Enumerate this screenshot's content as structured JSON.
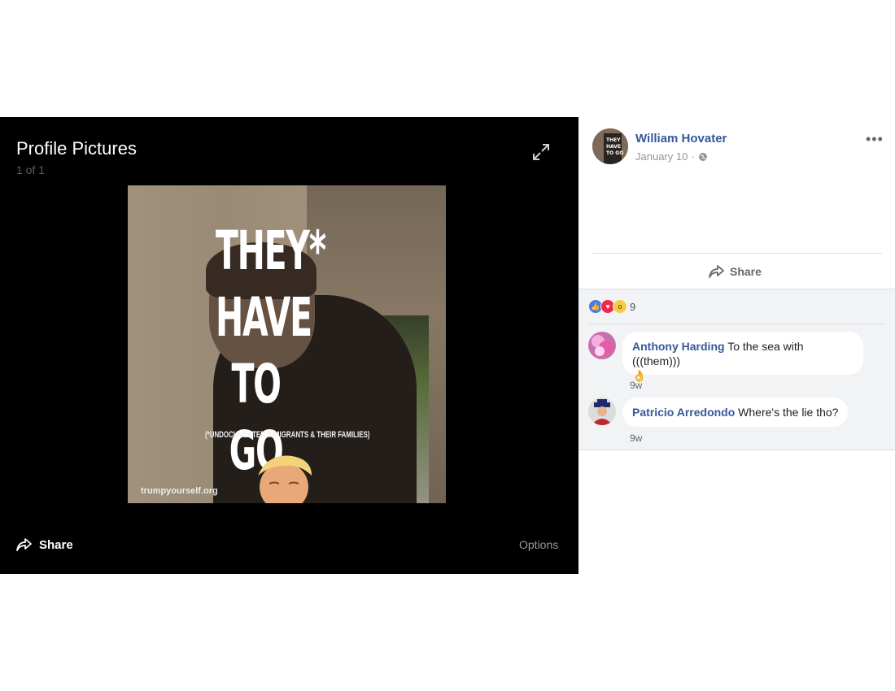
{
  "viewer": {
    "album_title": "Profile Pictures",
    "counter": "1 of 1",
    "share_label": "Share",
    "options_label": "Options"
  },
  "photo": {
    "headline_lines": [
      "THEY*",
      "HAVE",
      "TO GO"
    ],
    "footnote": "(*UNDOCUMENTED IMMIGRANTS & THEIR FAMILIES)",
    "watermark": "trumpyourself.org"
  },
  "post": {
    "author": "William Hovater",
    "date": "January 10",
    "share_label": "Share",
    "reaction_count": "9",
    "reactions": [
      "like-icon",
      "love-icon",
      "wow-icon"
    ]
  },
  "comments": [
    {
      "name": "Anthony Harding",
      "text": "To the sea with (((them)))",
      "time": "9w",
      "emoji": "ok-hand-icon"
    },
    {
      "name": "Patricio Arredondo",
      "text": "Where's the lie tho?",
      "time": "9w"
    }
  ],
  "colors": {
    "link_blue": "#365899",
    "viewer_bg": "#000000",
    "comment_bg": "#f2f3f5"
  }
}
